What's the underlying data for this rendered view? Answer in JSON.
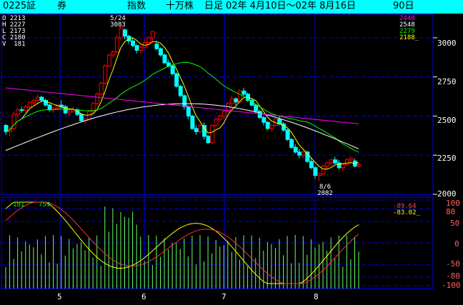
{
  "header": {
    "code": "0225証",
    "broker": "券",
    "index_type": "指数",
    "unit": "十万株",
    "period_type": "日足",
    "date_range": "02年 4月10日～02年 8月16日",
    "days": "90日"
  },
  "ohlc": {
    "open": "O 2213",
    "high": "H 2227",
    "low": "L 2173",
    "close": "C 2180",
    "volume": "V  181"
  },
  "moving_averages": [
    {
      "value": "2448",
      "color": "#ff00ff"
    },
    {
      "value": "2548",
      "color": "#ffffff"
    },
    {
      "value": "2279",
      "color": "#00ff00"
    },
    {
      "value": "2188_",
      "color": "#ffff00"
    }
  ],
  "annotations": {
    "high_date": "5/24",
    "high_value": "3083",
    "low_date": "8/6",
    "low_value": "2082"
  },
  "oscillator": {
    "left_vals": [
      "181",
      "754"
    ],
    "red_val": "-89.64",
    "yellow_val": "-83.02_"
  },
  "price_axis": [
    "3000",
    "2750",
    "2500",
    "2250",
    "2000"
  ],
  "osc_axis": [
    "100",
    "80",
    "50",
    "0",
    "-50",
    "-80",
    "-100"
  ],
  "x_axis": [
    "5",
    "6",
    "7",
    "8"
  ],
  "colors": {
    "up": "#ff0000",
    "down": "#00ffff",
    "ma_short": "#ffff00",
    "ma_mid": "#00ff00",
    "ma_long": "#ffffff",
    "ma_trend": "#ff00ff",
    "grid": "#0000ff",
    "volume": "#66ff66"
  },
  "chart_data": {
    "type": "candlestick",
    "ylim": [
      2000,
      3150
    ],
    "candles": [
      [
        2440,
        2450,
        2380,
        2400
      ],
      [
        2400,
        2430,
        2370,
        2420
      ],
      [
        2420,
        2530,
        2410,
        2510
      ],
      [
        2510,
        2550,
        2490,
        2540
      ],
      [
        2540,
        2560,
        2520,
        2535
      ],
      [
        2535,
        2570,
        2520,
        2560
      ],
      [
        2560,
        2600,
        2550,
        2585
      ],
      [
        2585,
        2610,
        2570,
        2600
      ],
      [
        2600,
        2640,
        2580,
        2620
      ],
      [
        2620,
        2630,
        2590,
        2600
      ],
      [
        2600,
        2610,
        2560,
        2570
      ],
      [
        2570,
        2580,
        2530,
        2540
      ],
      [
        2540,
        2560,
        2520,
        2550
      ],
      [
        2550,
        2580,
        2540,
        2570
      ],
      [
        2570,
        2600,
        2550,
        2560
      ],
      [
        2560,
        2570,
        2510,
        2520
      ],
      [
        2520,
        2540,
        2500,
        2530
      ],
      [
        2530,
        2560,
        2520,
        2540
      ],
      [
        2540,
        2550,
        2500,
        2510
      ],
      [
        2510,
        2520,
        2460,
        2470
      ],
      [
        2470,
        2490,
        2450,
        2480
      ],
      [
        2480,
        2540,
        2470,
        2530
      ],
      [
        2530,
        2590,
        2520,
        2580
      ],
      [
        2580,
        2650,
        2570,
        2640
      ],
      [
        2640,
        2720,
        2630,
        2710
      ],
      [
        2710,
        2830,
        2700,
        2820
      ],
      [
        2820,
        2900,
        2810,
        2890
      ],
      [
        2890,
        2920,
        2870,
        2910
      ],
      [
        2910,
        3020,
        2900,
        3000
      ],
      [
        3000,
        3083,
        2980,
        3060
      ],
      [
        3050,
        3060,
        2990,
        3010
      ],
      [
        3010,
        3020,
        2960,
        2980
      ],
      [
        2980,
        3000,
        2940,
        2950
      ],
      [
        2950,
        2960,
        2900,
        2920
      ],
      [
        2920,
        2950,
        2900,
        2940
      ],
      [
        2940,
        2990,
        2930,
        2970
      ],
      [
        2970,
        3010,
        2960,
        3000
      ],
      [
        3000,
        3020,
        2970,
        3040
      ],
      [
        2960,
        2980,
        2920,
        2930
      ],
      [
        2930,
        2940,
        2880,
        2890
      ],
      [
        2890,
        2900,
        2830,
        2840
      ],
      [
        2840,
        2860,
        2810,
        2820
      ],
      [
        2820,
        2830,
        2760,
        2770
      ],
      [
        2770,
        2780,
        2680,
        2690
      ],
      [
        2690,
        2700,
        2620,
        2630
      ],
      [
        2630,
        2640,
        2540,
        2560
      ],
      [
        2560,
        2570,
        2480,
        2500
      ],
      [
        2500,
        2510,
        2410,
        2420
      ],
      [
        2420,
        2440,
        2380,
        2400
      ],
      [
        2400,
        2450,
        2390,
        2440
      ],
      [
        2440,
        2460,
        2350,
        2370
      ],
      [
        2370,
        2380,
        2320,
        2330
      ],
      [
        2330,
        2450,
        2320,
        2440
      ],
      [
        2440,
        2490,
        2430,
        2480
      ],
      [
        2480,
        2510,
        2460,
        2500
      ],
      [
        2500,
        2540,
        2480,
        2530
      ],
      [
        2530,
        2590,
        2520,
        2580
      ],
      [
        2580,
        2630,
        2560,
        2610
      ],
      [
        2610,
        2620,
        2570,
        2590
      ],
      [
        2590,
        2670,
        2580,
        2660
      ],
      [
        2660,
        2680,
        2630,
        2640
      ],
      [
        2640,
        2650,
        2590,
        2600
      ],
      [
        2600,
        2610,
        2560,
        2570
      ],
      [
        2570,
        2580,
        2520,
        2530
      ],
      [
        2530,
        2540,
        2480,
        2490
      ],
      [
        2490,
        2500,
        2440,
        2460
      ],
      [
        2460,
        2470,
        2410,
        2420
      ],
      [
        2420,
        2450,
        2400,
        2440
      ],
      [
        2440,
        2490,
        2430,
        2480
      ],
      [
        2480,
        2500,
        2440,
        2450
      ],
      [
        2450,
        2460,
        2400,
        2410
      ],
      [
        2410,
        2420,
        2340,
        2350
      ],
      [
        2350,
        2360,
        2290,
        2300
      ],
      [
        2300,
        2320,
        2260,
        2270
      ],
      [
        2270,
        2290,
        2230,
        2250
      ],
      [
        2250,
        2280,
        2230,
        2270
      ],
      [
        2270,
        2280,
        2200,
        2210
      ],
      [
        2210,
        2230,
        2160,
        2170
      ],
      [
        2170,
        2180,
        2100,
        2120
      ],
      [
        2120,
        2140,
        2082,
        2130
      ],
      [
        2130,
        2190,
        2120,
        2180
      ],
      [
        2180,
        2210,
        2160,
        2200
      ],
      [
        2200,
        2230,
        2180,
        2220
      ],
      [
        2220,
        2240,
        2190,
        2200
      ],
      [
        2200,
        2220,
        2160,
        2170
      ],
      [
        2170,
        2200,
        2150,
        2190
      ],
      [
        2190,
        2230,
        2180,
        2220
      ],
      [
        2220,
        2240,
        2200,
        2230
      ],
      [
        2213,
        2227,
        2173,
        2180
      ],
      [
        2180,
        2200,
        2170,
        2190
      ]
    ],
    "volume_max": 100
  }
}
